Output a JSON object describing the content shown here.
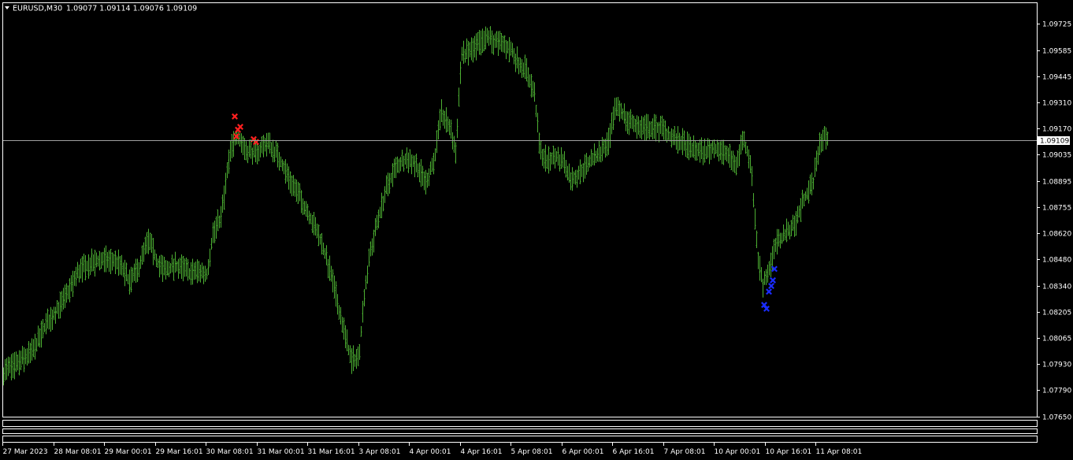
{
  "header": {
    "symbol": "EURUSD,M30",
    "ohlc": "1.09077 1.09114 1.09076 1.09109"
  },
  "colors": {
    "background": "#000000",
    "frame": "#ffffff",
    "bars": "#4caf32",
    "sell_signal": "#ff2020",
    "buy_signal": "#1a2cff",
    "price_line": "#a0a0a0"
  },
  "chart_data": {
    "type": "bar",
    "symbol": "EURUSD",
    "timeframe": "M30",
    "current_price": 1.09109,
    "current_price_label": "1.09109",
    "ylim": [
      1.0758,
      1.098
    ],
    "yticks": [
      "1.09725",
      "1.09585",
      "1.09445",
      "1.09310",
      "1.09170",
      "1.09035",
      "1.08895",
      "1.08755",
      "1.08620",
      "1.08480",
      "1.08340",
      "1.08205",
      "1.08065",
      "1.07930",
      "1.07790",
      "1.07650"
    ],
    "xtick_labels": [
      "27 Mar 2023",
      "28 Mar 08:01",
      "29 Mar 00:01",
      "29 Mar 16:01",
      "30 Mar 08:01",
      "31 Mar 00:01",
      "31 Mar 16:01",
      "3 Apr 08:01",
      "4 Apr 00:01",
      "4 Apr 16:01",
      "5 Apr 08:01",
      "6 Apr 00:01",
      "6 Apr 16:01",
      "7 Apr 08:01",
      "10 Apr 00:01",
      "10 Apr 16:01",
      "11 Apr 08:01"
    ],
    "price_path": [
      [
        0,
        1.0788
      ],
      [
        15,
        1.0791
      ],
      [
        40,
        1.0799
      ],
      [
        60,
        1.0815
      ],
      [
        80,
        1.0826
      ],
      [
        100,
        1.0842
      ],
      [
        115,
        1.0846
      ],
      [
        135,
        1.0848
      ],
      [
        150,
        1.0846
      ],
      [
        165,
        1.0836
      ],
      [
        175,
        1.0843
      ],
      [
        188,
        1.0858
      ],
      [
        200,
        1.0846
      ],
      [
        210,
        1.0842
      ],
      [
        225,
        1.0845
      ],
      [
        240,
        1.0841
      ],
      [
        250,
        1.0842
      ],
      [
        262,
        1.084
      ],
      [
        270,
        1.0862
      ],
      [
        280,
        1.087
      ],
      [
        292,
        1.0905
      ],
      [
        300,
        1.0914
      ],
      [
        312,
        1.0906
      ],
      [
        325,
        1.0904
      ],
      [
        338,
        1.091
      ],
      [
        350,
        1.0904
      ],
      [
        362,
        1.0895
      ],
      [
        375,
        1.0885
      ],
      [
        390,
        1.0873
      ],
      [
        405,
        1.086
      ],
      [
        420,
        1.084
      ],
      [
        432,
        1.0818
      ],
      [
        445,
        1.0795
      ],
      [
        455,
        1.0796
      ],
      [
        462,
        1.083
      ],
      [
        470,
        1.0852
      ],
      [
        480,
        1.087
      ],
      [
        490,
        1.0885
      ],
      [
        500,
        1.0895
      ],
      [
        515,
        1.0902
      ],
      [
        528,
        1.0898
      ],
      [
        540,
        1.0889
      ],
      [
        550,
        1.0899
      ],
      [
        560,
        1.0925
      ],
      [
        570,
        1.0918
      ],
      [
        578,
        1.0905
      ],
      [
        585,
        1.0955
      ],
      [
        595,
        1.0958
      ],
      [
        608,
        1.0962
      ],
      [
        620,
        1.0965
      ],
      [
        632,
        1.0962
      ],
      [
        645,
        1.096
      ],
      [
        658,
        1.0952
      ],
      [
        668,
        1.0948
      ],
      [
        678,
        1.0935
      ],
      [
        685,
        1.0905
      ],
      [
        695,
        1.09
      ],
      [
        705,
        1.0902
      ],
      [
        715,
        1.09
      ],
      [
        725,
        1.089
      ],
      [
        738,
        1.0895
      ],
      [
        750,
        1.09
      ],
      [
        762,
        1.0905
      ],
      [
        772,
        1.091
      ],
      [
        782,
        1.093
      ],
      [
        795,
        1.0922
      ],
      [
        810,
        1.0918
      ],
      [
        825,
        1.0918
      ],
      [
        840,
        1.0917
      ],
      [
        852,
        1.0912
      ],
      [
        865,
        1.091
      ],
      [
        880,
        1.0906
      ],
      [
        895,
        1.0905
      ],
      [
        910,
        1.0907
      ],
      [
        925,
        1.0902
      ],
      [
        935,
        1.0898
      ],
      [
        942,
        1.0912
      ],
      [
        952,
        1.09
      ],
      [
        958,
        1.087
      ],
      [
        962,
        1.0848
      ],
      [
        968,
        1.0835
      ],
      [
        975,
        1.0842
      ],
      [
        985,
        1.0856
      ],
      [
        998,
        1.0862
      ],
      [
        1010,
        1.0868
      ],
      [
        1020,
        1.088
      ],
      [
        1032,
        1.0889
      ],
      [
        1040,
        1.091
      ],
      [
        1046,
        1.0913
      ],
      [
        1050,
        1.0911
      ]
    ],
    "sell_signals": [
      [
        298,
        1.09235
      ],
      [
        302,
        1.09165
      ],
      [
        305,
        1.0918
      ],
      [
        300,
        1.0913
      ],
      [
        322,
        1.09115
      ],
      [
        325,
        1.091
      ]
    ],
    "buy_signals": [
      [
        983,
        1.0843
      ],
      [
        981,
        1.0837
      ],
      [
        979,
        1.0834
      ],
      [
        976,
        1.0831
      ],
      [
        970,
        1.0824
      ],
      [
        973,
        1.0822
      ]
    ]
  }
}
